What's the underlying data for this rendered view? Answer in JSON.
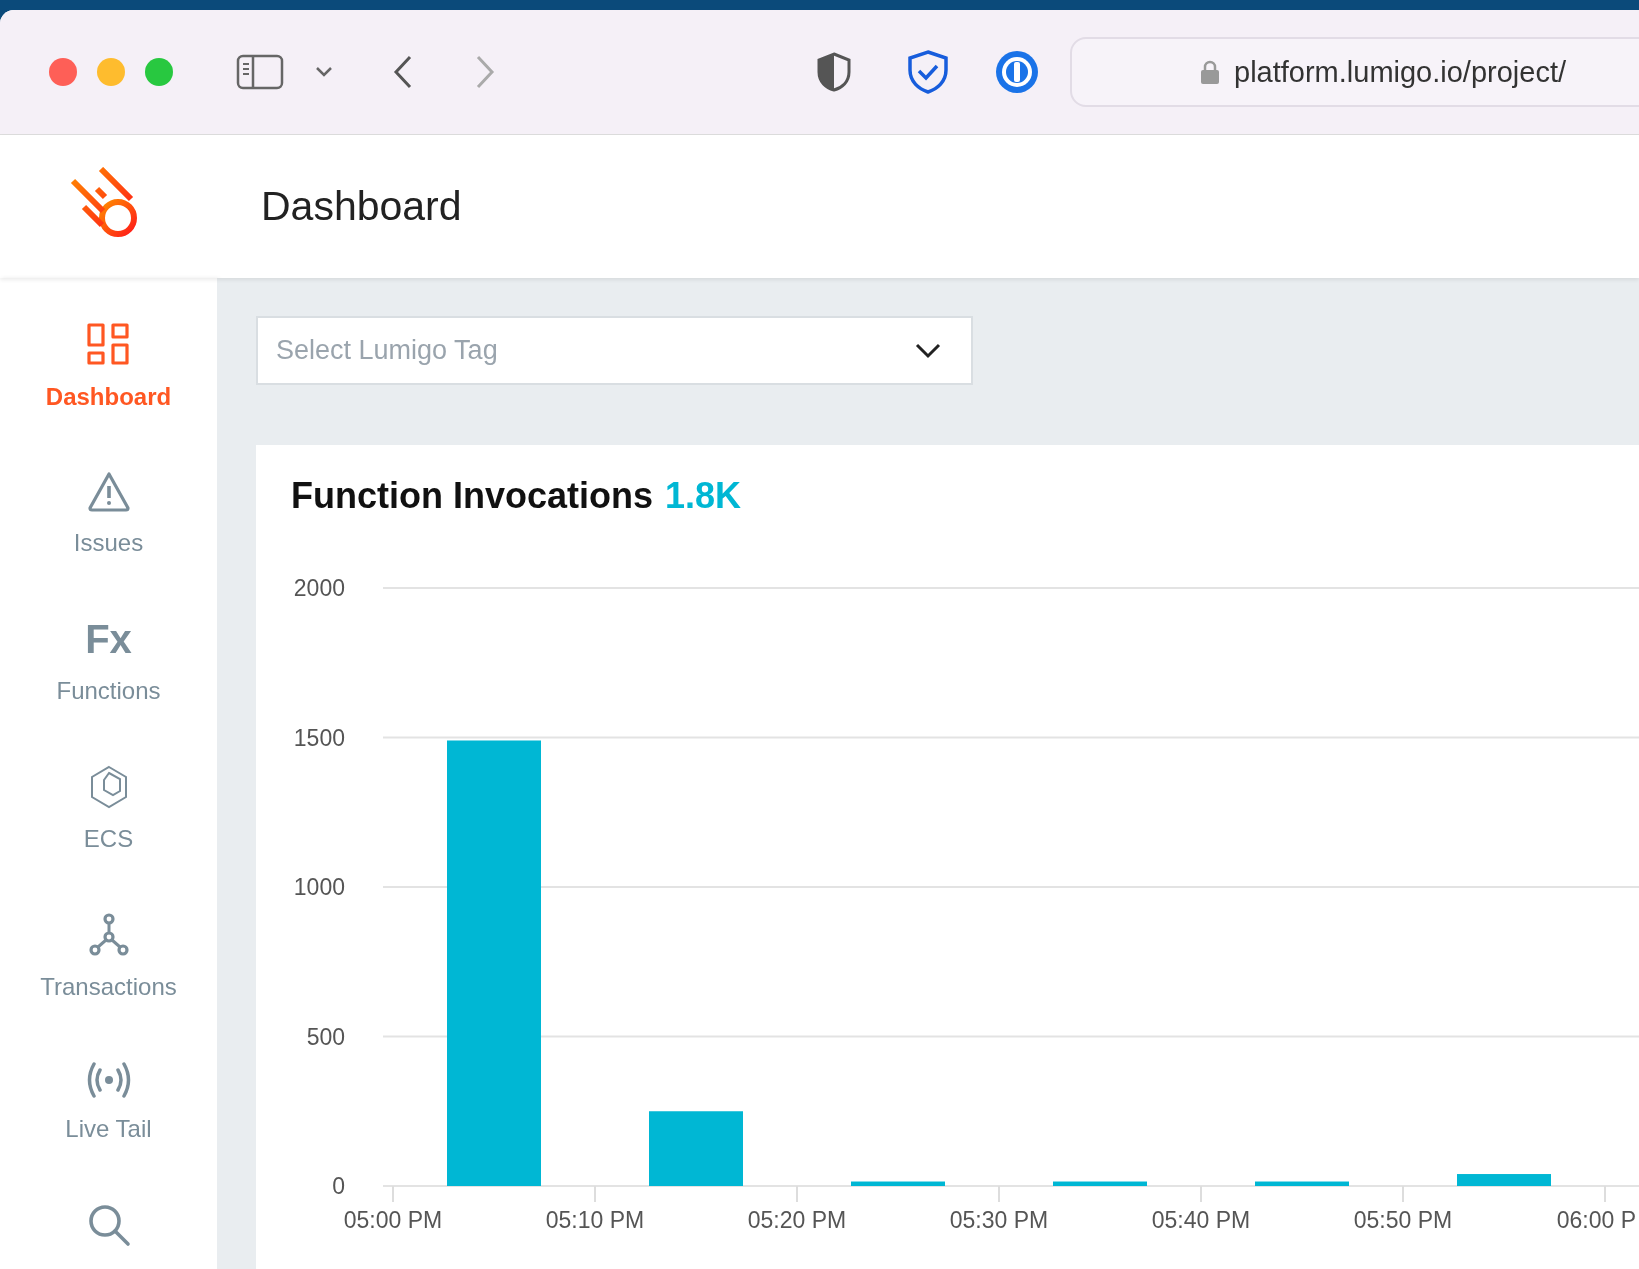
{
  "browser": {
    "url": "platform.lumigo.io/project/"
  },
  "header": {
    "title": "Dashboard"
  },
  "sidebar": {
    "items": [
      {
        "kind": "dashboard",
        "label": "Dashboard",
        "selected": true
      },
      {
        "kind": "issues",
        "label": "Issues",
        "selected": false
      },
      {
        "kind": "functions",
        "label": "Functions",
        "selected": false,
        "glyph": "Fx"
      },
      {
        "kind": "ecs",
        "label": "ECS",
        "selected": false
      },
      {
        "kind": "transactions",
        "label": "Transactions",
        "selected": false
      },
      {
        "kind": "livetail",
        "label": "Live Tail",
        "selected": false
      },
      {
        "kind": "search",
        "selected": false
      }
    ]
  },
  "tag_select": {
    "placeholder": "Select Lumigo Tag"
  },
  "card": {
    "title": "Function Invocations",
    "total": "1.8K",
    "chart_data": {
      "type": "bar",
      "categories": [
        "05:00 PM",
        null,
        "05:10 PM",
        null,
        "05:20 PM",
        null,
        "05:30 PM",
        null,
        "05:40 PM",
        null,
        "05:50 PM",
        null,
        "06:00 P"
      ],
      "series": [
        {
          "color": "#00b7d4",
          "values": [
            null,
            1490,
            null,
            250,
            null,
            15,
            null,
            15,
            null,
            15,
            null,
            40,
            null
          ]
        }
      ],
      "ylim": [
        0,
        2000
      ],
      "grid": true,
      "yticks": [
        0,
        500,
        1000,
        1500,
        2000
      ]
    }
  }
}
